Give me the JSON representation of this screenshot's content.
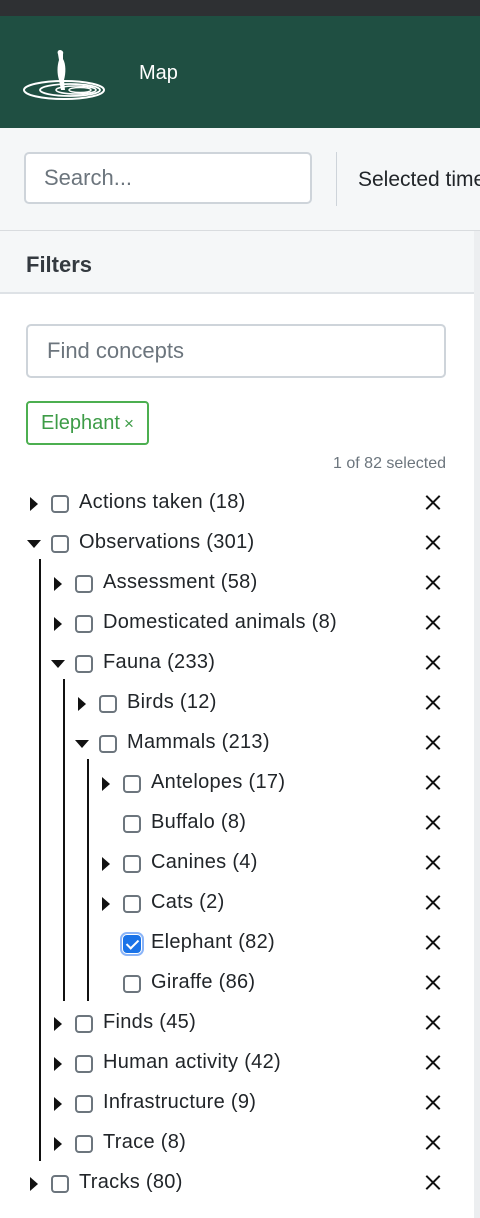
{
  "header": {
    "nav_map": "Map"
  },
  "toolbar": {
    "search_placeholder": "Search...",
    "time_label": "Selected time"
  },
  "filters": {
    "title": "Filters",
    "concepts_placeholder": "Find concepts",
    "chip": {
      "label": "Elephant",
      "remove": "×"
    },
    "selected_count": "1 of 82 selected",
    "tree": [
      {
        "label": "Actions taken (18)",
        "depth": 0,
        "expander": "collapsed",
        "checked": false
      },
      {
        "label": "Observations (301)",
        "depth": 0,
        "expander": "expanded",
        "checked": false
      },
      {
        "label": "Assessment (58)",
        "depth": 1,
        "expander": "collapsed",
        "checked": false
      },
      {
        "label": "Domesticated animals (8)",
        "depth": 1,
        "expander": "collapsed",
        "checked": false
      },
      {
        "label": "Fauna (233)",
        "depth": 1,
        "expander": "expanded",
        "checked": false
      },
      {
        "label": "Birds (12)",
        "depth": 2,
        "expander": "collapsed",
        "checked": false
      },
      {
        "label": "Mammals (213)",
        "depth": 2,
        "expander": "expanded",
        "checked": false
      },
      {
        "label": "Antelopes (17)",
        "depth": 3,
        "expander": "collapsed",
        "checked": false
      },
      {
        "label": "Buffalo (8)",
        "depth": 3,
        "expander": "none",
        "checked": false
      },
      {
        "label": "Canines (4)",
        "depth": 3,
        "expander": "collapsed",
        "checked": false
      },
      {
        "label": "Cats (2)",
        "depth": 3,
        "expander": "collapsed",
        "checked": false
      },
      {
        "label": "Elephant (82)",
        "depth": 3,
        "expander": "none",
        "checked": true
      },
      {
        "label": "Giraffe (86)",
        "depth": 3,
        "expander": "none",
        "checked": false
      },
      {
        "label": "Finds (45)",
        "depth": 1,
        "expander": "collapsed",
        "checked": false
      },
      {
        "label": "Human activity (42)",
        "depth": 1,
        "expander": "collapsed",
        "checked": false
      },
      {
        "label": "Infrastructure (9)",
        "depth": 1,
        "expander": "collapsed",
        "checked": false
      },
      {
        "label": "Trace (8)",
        "depth": 1,
        "expander": "collapsed",
        "checked": false
      },
      {
        "label": "Tracks (80)",
        "depth": 0,
        "expander": "collapsed",
        "checked": false
      }
    ]
  },
  "colors": {
    "header_bg": "#1f4f42",
    "chip": "#4caf50",
    "checkbox_checked": "#1a73e8"
  }
}
